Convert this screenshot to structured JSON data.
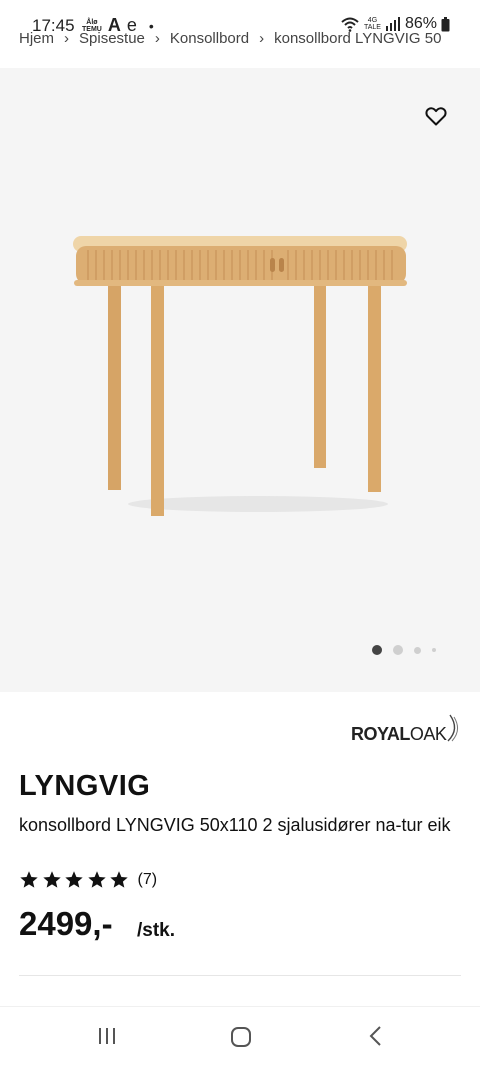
{
  "status_bar": {
    "time": "17:45",
    "tiny_app_icon_label": "Ålø\nTEMU",
    "letter_a": "A",
    "letter_e": "e",
    "dot": "•",
    "network": "4G\nTALE",
    "battery": "86%"
  },
  "breadcrumb": [
    "Hjem",
    "Spisestue",
    "Konsollbord",
    "konsollbord LYNGVIG 50"
  ],
  "gallery": {
    "background": "#f5f5f5",
    "active_slide": 1,
    "slide_count": 4
  },
  "brand": {
    "part1": "ROYAL",
    "part2": "OAK"
  },
  "product": {
    "name": "LYNGVIG",
    "description": "konsollbord LYNGVIG 50x110 2 sjalusidører na-tur eik",
    "rating_stars": 5,
    "review_count": "(7)",
    "price": "2499,-",
    "unit": "/stk."
  },
  "icons": {
    "favorite": "heart-outline-icon",
    "nav_recent": "recent-apps-icon",
    "nav_home": "home-icon",
    "nav_back": "back-icon"
  }
}
